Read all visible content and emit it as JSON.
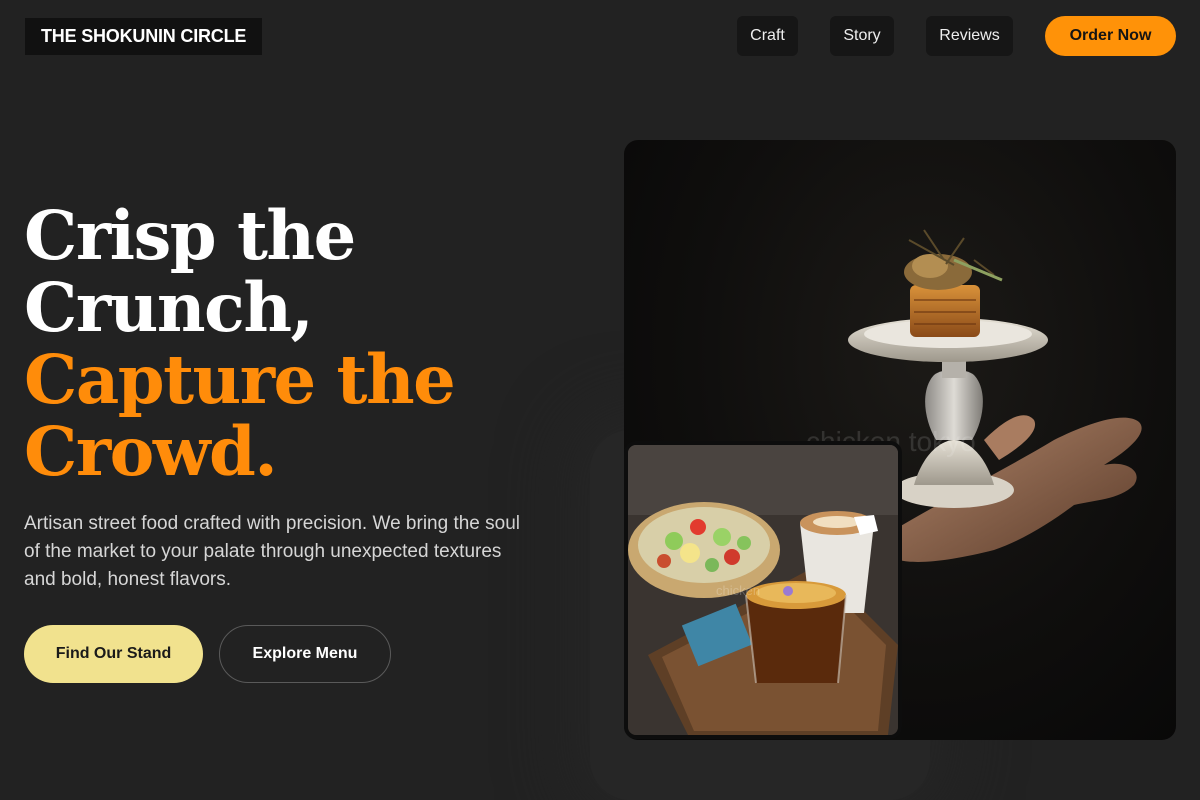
{
  "brand": {
    "logo_text": "THE SHOKUNIN CIRCLE"
  },
  "nav": {
    "items": [
      {
        "label": "Craft"
      },
      {
        "label": "Story"
      },
      {
        "label": "Reviews"
      }
    ],
    "cta_label": "Order Now"
  },
  "hero": {
    "headline_lines": [
      "Crisp the",
      "Crunch,",
      "Capture the",
      "Crowd."
    ],
    "description": "Artisan street food crafted with precision. We bring the soul of the market to your palate through unexpected textures and bold, honest flavors.",
    "primary_cta": "Find Our Stand",
    "secondary_cta": "Explore Menu"
  },
  "images": {
    "main_watermark": "chicken tokyo",
    "inset_watermark": "chicken"
  },
  "colors": {
    "background": "#222222",
    "accent": "#ff8c0a",
    "order_button": "#ff9208",
    "primary_cta": "#f1e28e"
  }
}
